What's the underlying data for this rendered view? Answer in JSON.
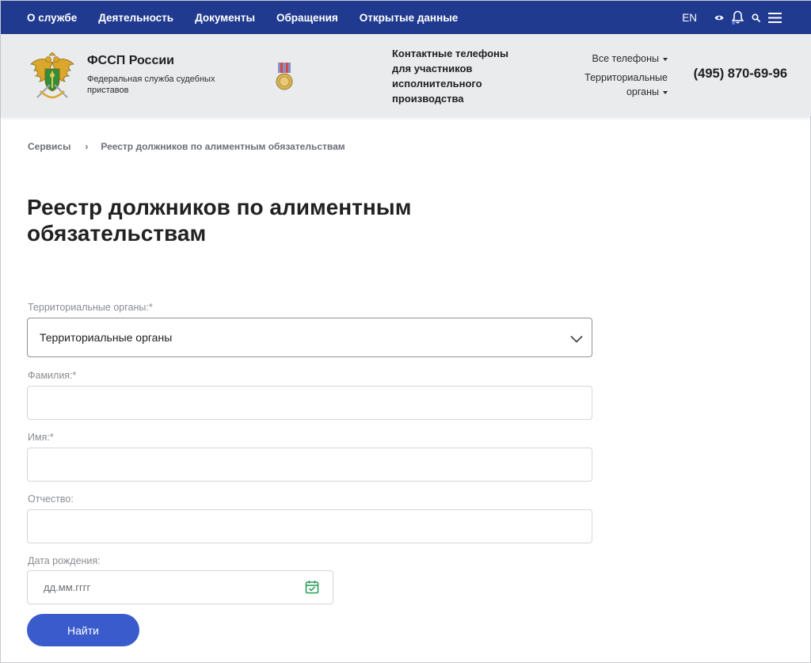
{
  "topnav": {
    "items": [
      "О службе",
      "Деятельность",
      "Документы",
      "Обращения",
      "Открытые данные"
    ],
    "lang": "EN",
    "icons": [
      "eye-icon",
      "bell-icon",
      "search-icon",
      "menu-icon"
    ]
  },
  "header": {
    "org_title": "ФССП России",
    "org_subtitle": "Федеральная служба судебных приставов",
    "contacts_title": "Контактные телефоны для участников исполнительного производства",
    "all_phones": "Все телефоны",
    "territorial_organs": "Территориальные органы",
    "phone": "(495) 870-69-96"
  },
  "breadcrumb": {
    "items": [
      "Сервисы",
      "Реестр должников по алиментным обязательствам"
    ],
    "separator": "›"
  },
  "page": {
    "title": "Реестр должников по алиментным обязательствам"
  },
  "form": {
    "territory_label": "Территориальные органы:*",
    "territory_value": "Территориальные органы",
    "surname_label": "Фамилия:*",
    "surname_value": "",
    "name_label": "Имя:*",
    "name_value": "",
    "patronymic_label": "Отчество:",
    "patronymic_value": "",
    "birthdate_label": "Дата рождения:",
    "birthdate_placeholder": "дд.мм.гггг",
    "submit_label": "Найти"
  },
  "colors": {
    "nav_bg": "#203a8f",
    "header_bg": "#e9ebed",
    "button_bg": "#3a5bcc",
    "calendar_icon": "#2e9e5c"
  }
}
